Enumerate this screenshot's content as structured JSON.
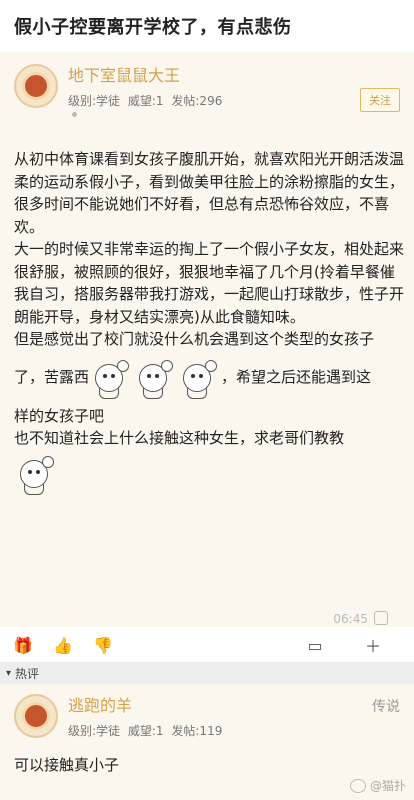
{
  "header": {
    "title": "假小子控要离开学校了，有点悲伤"
  },
  "post": {
    "author": {
      "name": "地下室鼠鼠大王",
      "level_label": "级别:学徒",
      "reputation_label": "威望:1",
      "posts_label": "发帖:296"
    },
    "follow_label": "关注",
    "paragraphs": [
      "从初中体育课看到女孩子腹肌开始，就喜欢阳光开朗活泼温柔的运动系假小子，看到做美甲往脸上的涂粉擦脂的女生，很多时间不能说她们不好看，但总有点恐怖谷效应，不喜欢。",
      "大一的时候又非常幸运的掏上了一个假小子女友，相处起来很舒服，被照顾的很好，狠狠地幸福了几个月(拎着早餐催我自习，搭服务器带我打游戏，一起爬山打球散步，性子开朗能开导，身材又结实漂亮)从此食髓知味。",
      "但是感觉出了校门就没什么机会遇到这个类型的女孩子"
    ],
    "line_sticker_prefix": "了，苦露西",
    "line_sticker_suffix": "，希望之后还能遇到这",
    "paragraph_after": "样的女孩子吧",
    "paragraph_last": "也不知道社会上什么接触这种女生，求老哥们教教",
    "time": "06:45"
  },
  "hot_label": "热评",
  "comment": {
    "author": {
      "name": "逃跑的羊",
      "level_label": "级别:学徒",
      "reputation_label": "威望:1",
      "posts_label": "发帖:119"
    },
    "reply_label": "传说",
    "text": "可以接触真小子"
  },
  "watermark": "@猫扑"
}
